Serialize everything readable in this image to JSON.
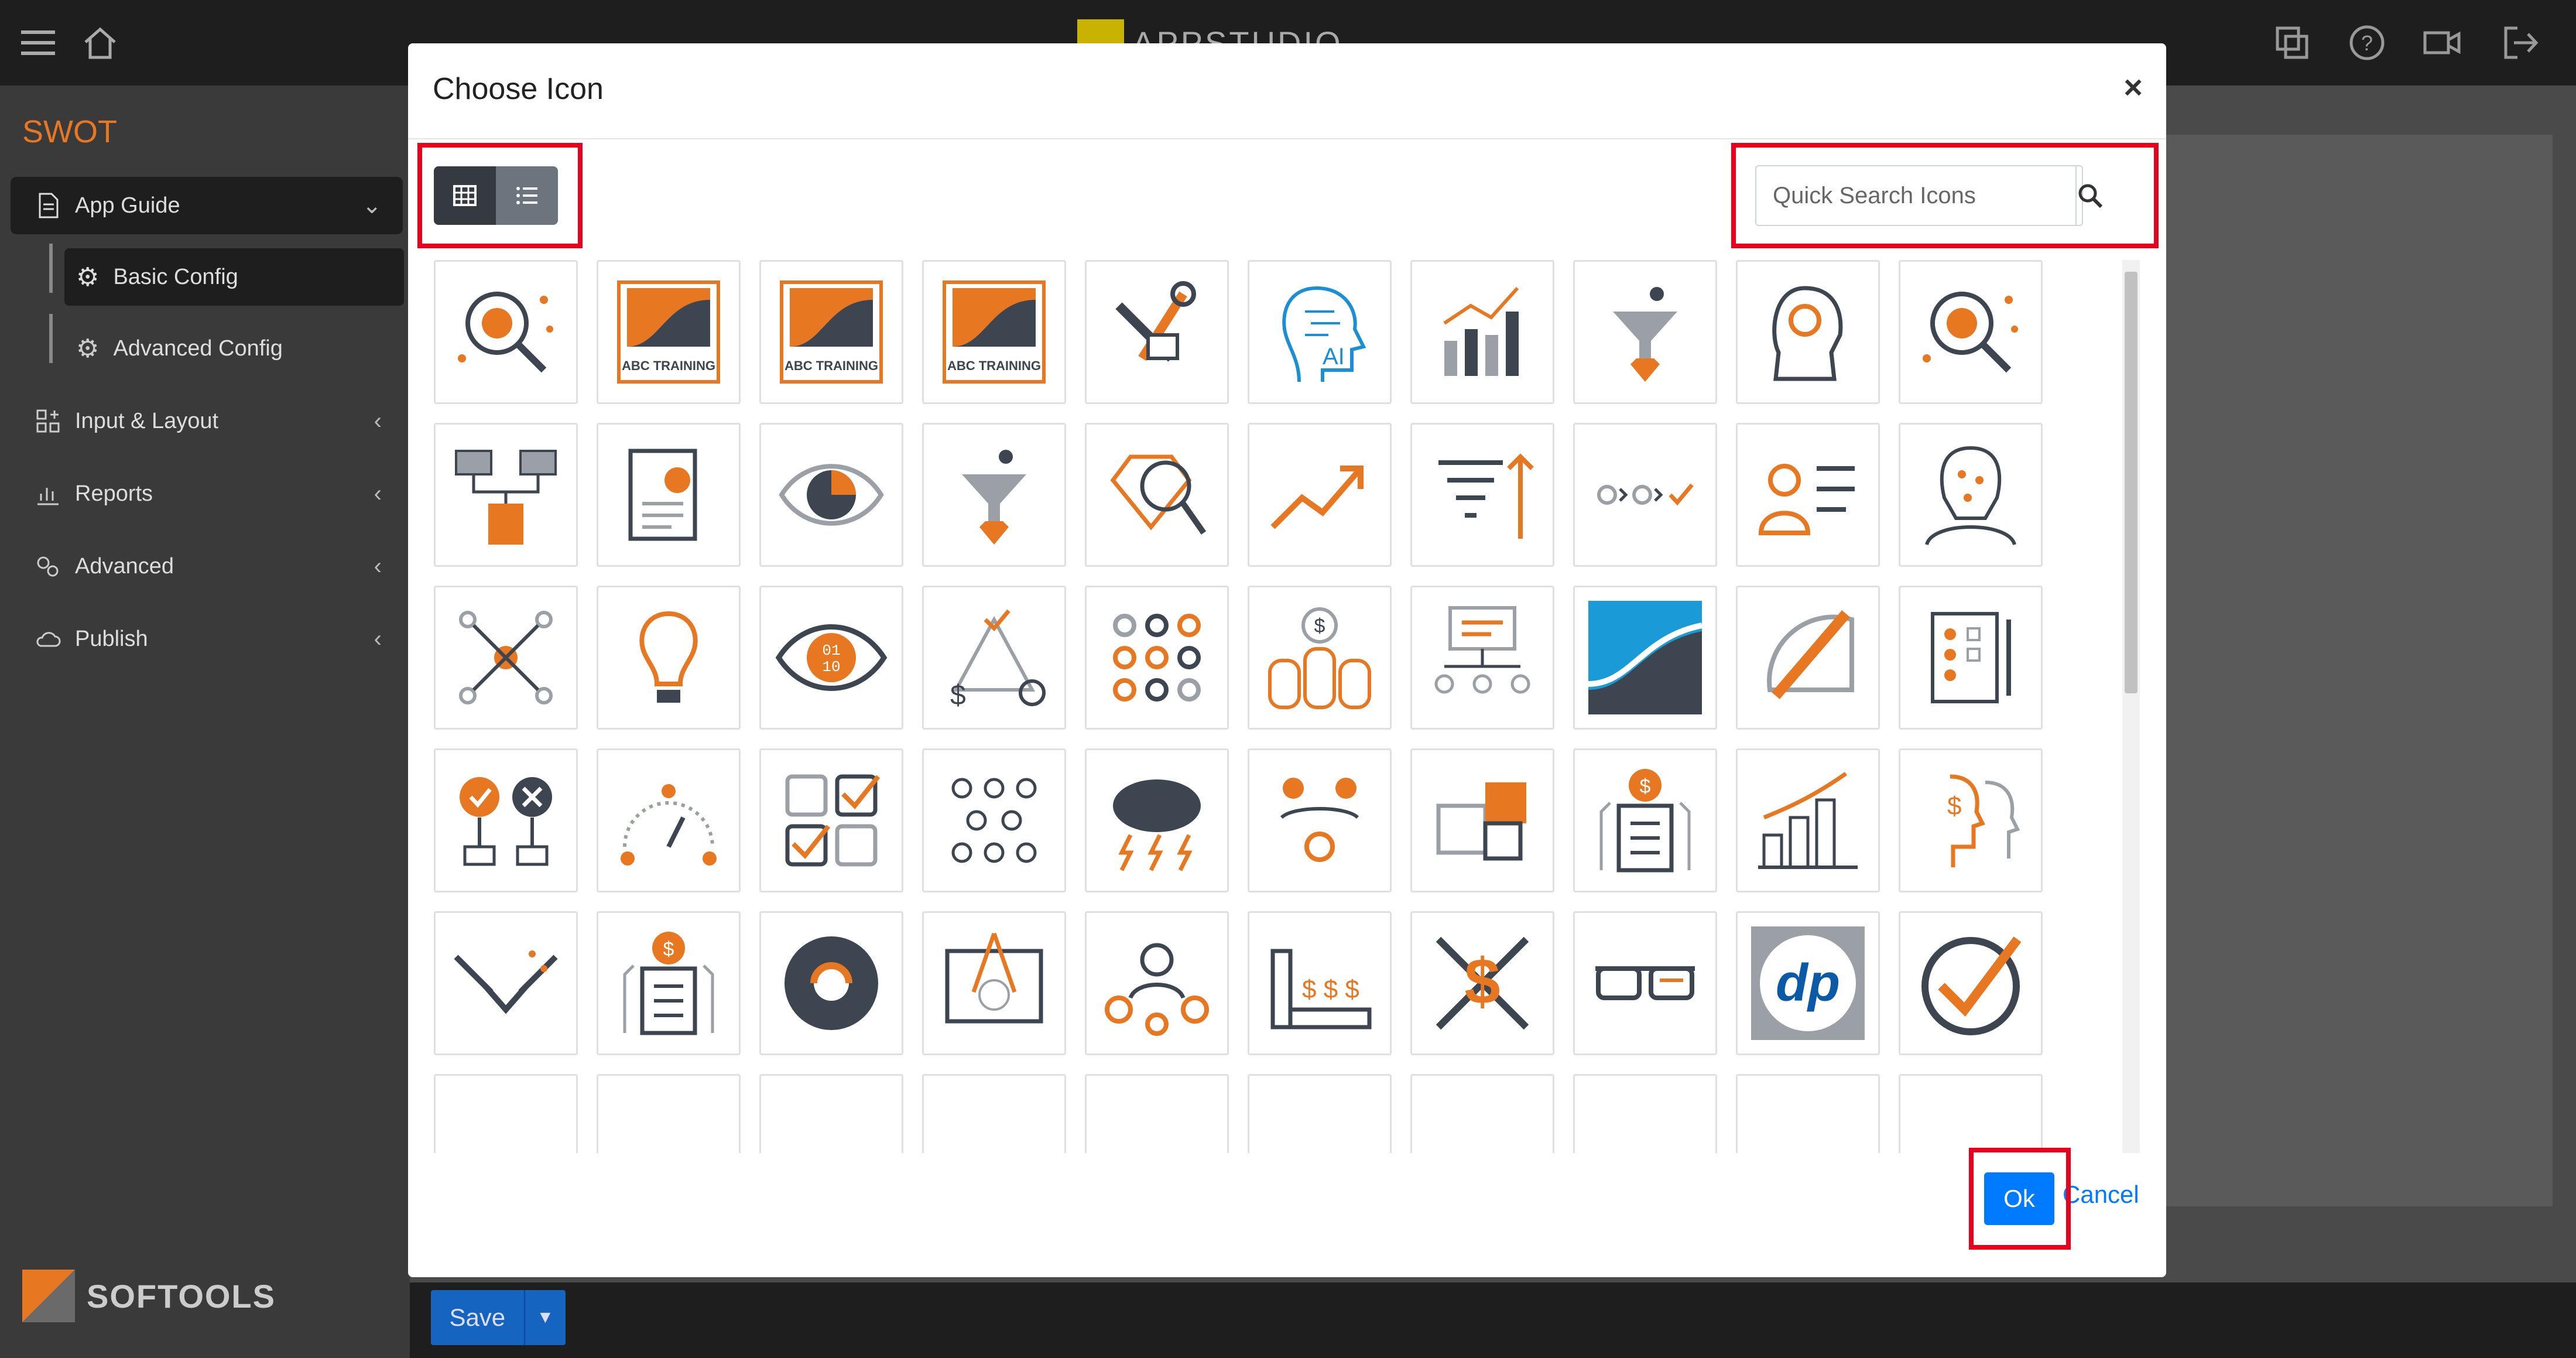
{
  "app": {
    "brand": "APPSTUDIO",
    "name": "SWOT",
    "footer_brand": "SOFTOOLS"
  },
  "sidebar": {
    "items": [
      {
        "label": "App Guide",
        "icon": "document-icon",
        "expanded": true
      },
      {
        "label": "Basic Config",
        "icon": "gear-icon"
      },
      {
        "label": "Advanced Config",
        "icon": "gear-icon"
      },
      {
        "label": "Input & Layout",
        "icon": "grid-plus-icon"
      },
      {
        "label": "Reports",
        "icon": "bar-chart-icon"
      },
      {
        "label": "Advanced",
        "icon": "gears-icon"
      },
      {
        "label": "Publish",
        "icon": "cloud-icon"
      }
    ]
  },
  "footer": {
    "save_label": "Save"
  },
  "modal": {
    "title": "Choose Icon",
    "close_label": "×",
    "search_placeholder": "Quick Search Icons",
    "ok_label": "Ok",
    "cancel_label": "Cancel",
    "view_mode": "grid",
    "tile_text": "ABC TRAINING",
    "icons": [
      "analysis-search-icon",
      "abc-training-logo",
      "abc-training-logo",
      "abc-training-logo",
      "tools-hand-icon",
      "ai-head-icon",
      "growth-chart-icon",
      "funnel-diamond-icon",
      "gear-head-icon",
      "analysis-search-icon",
      "folder-flow-icon",
      "report-scroll-icon",
      "eye-pie-icon",
      "funnel-diamond-icon",
      "diamond-search-icon",
      "trend-up-icon",
      "filter-sort-icon",
      "process-steps-icon",
      "user-list-icon",
      "brain-network-icon",
      "network-nodes-icon",
      "lightbulb-icon",
      "binary-eye-icon",
      "money-time-triangle-icon",
      "dots-grid-icon",
      "coins-stack-icon",
      "presentation-team-icon",
      "wave-logo",
      "ruler-pencil-icon",
      "checklist-scroll-icon",
      "approve-reject-icon",
      "satisfaction-gauge-icon",
      "checkbox-grid-icon",
      "crowd-icon",
      "storm-brain-icon",
      "team-ideas-icon",
      "puzzle-icon",
      "building-dollar-icon",
      "city-growth-icon",
      "heads-dollar-icon",
      "handshake-icon",
      "building-dollar-icon",
      "aperture-icon",
      "blueprint-icon",
      "team-gears-icon",
      "dollar-conveyor-icon",
      "dollar-tools-icon",
      "smart-glasses-icon",
      "dp-logo",
      "checkmark-circle-icon"
    ]
  },
  "colors": {
    "accent": "#e87722",
    "dark": "#3d4550",
    "primary": "#007bff",
    "highlight": "#e8001c"
  }
}
